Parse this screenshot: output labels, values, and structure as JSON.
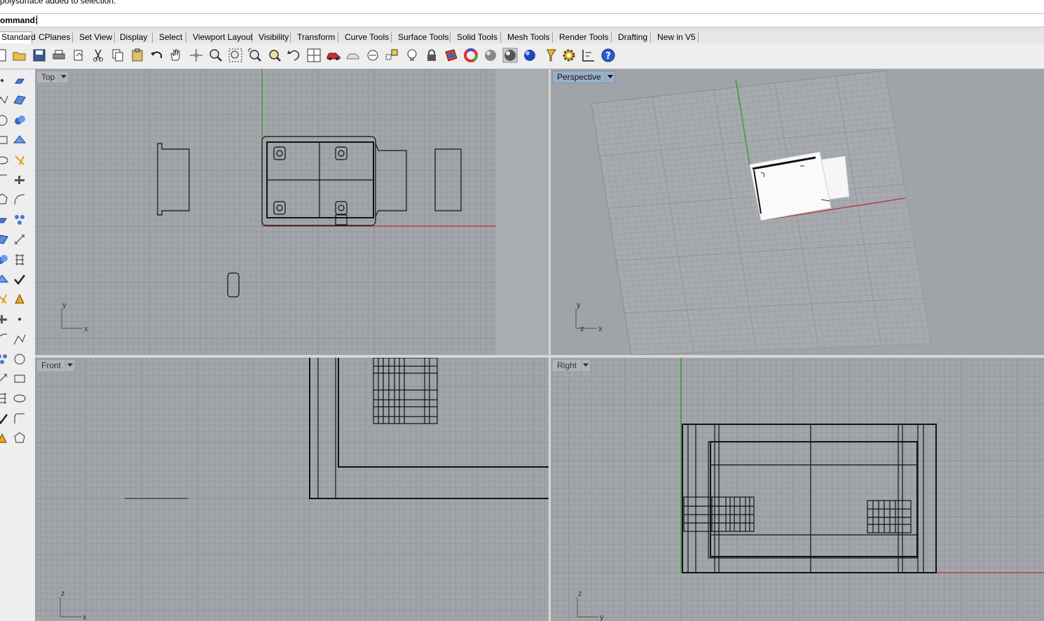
{
  "history": {
    "last_line": "polysurface added to selection."
  },
  "command": {
    "label": "ommand:",
    "value": ""
  },
  "tabs": [
    {
      "label": "Standard",
      "active": true
    },
    {
      "label": "CPlanes"
    },
    {
      "label": "Set View"
    },
    {
      "label": "Display"
    },
    {
      "label": "Select"
    },
    {
      "label": "Viewport Layout"
    },
    {
      "label": "Visibility"
    },
    {
      "label": "Transform"
    },
    {
      "label": "Curve Tools"
    },
    {
      "label": "Surface Tools"
    },
    {
      "label": "Solid Tools"
    },
    {
      "label": "Mesh Tools"
    },
    {
      "label": "Render Tools"
    },
    {
      "label": "Drafting"
    },
    {
      "label": "New in V5"
    }
  ],
  "toolbar_icons": [
    "new-icon",
    "open-icon",
    "save-icon",
    "print-icon",
    "import-icon",
    "cut-icon",
    "copy-icon",
    "paste-icon",
    "undo-icon",
    "pan-icon",
    "rotate-view-icon",
    "zoom-dynamic-icon",
    "zoom-window-icon",
    "zoom-extents-icon",
    "zoom-selected-icon",
    "rotate-icon",
    "four-viewports-icon",
    "car-icon",
    "ghost-icon",
    "circle-dot-icon",
    "snap-icon",
    "lightbulb-icon",
    "lock-icon",
    "layers-icon",
    "color-wheel-icon",
    "shaded-sphere-icon",
    "rendered-sphere-icon",
    "blue-sphere-icon",
    "highlight-icon",
    "options-gear-icon",
    "dimension-icon",
    "help-icon"
  ],
  "viewports": {
    "top": {
      "title": "Top",
      "axis1": "x",
      "axis2": "y"
    },
    "perspective": {
      "title": "Perspective",
      "axis1": "x",
      "axis2": "y",
      "axis3": "z"
    },
    "front": {
      "title": "Front",
      "axis1": "x",
      "axis2": "z"
    },
    "right": {
      "title": "Right",
      "axis1": "y",
      "axis2": "z"
    }
  },
  "colors": {
    "grid_bg": "#a2a6ab",
    "grid_minor": "#969a9f",
    "grid_major": "#8b8f94",
    "x_axis": "#b03030",
    "y_axis": "#2a9a2a",
    "active_title": "#9ab0c8"
  }
}
